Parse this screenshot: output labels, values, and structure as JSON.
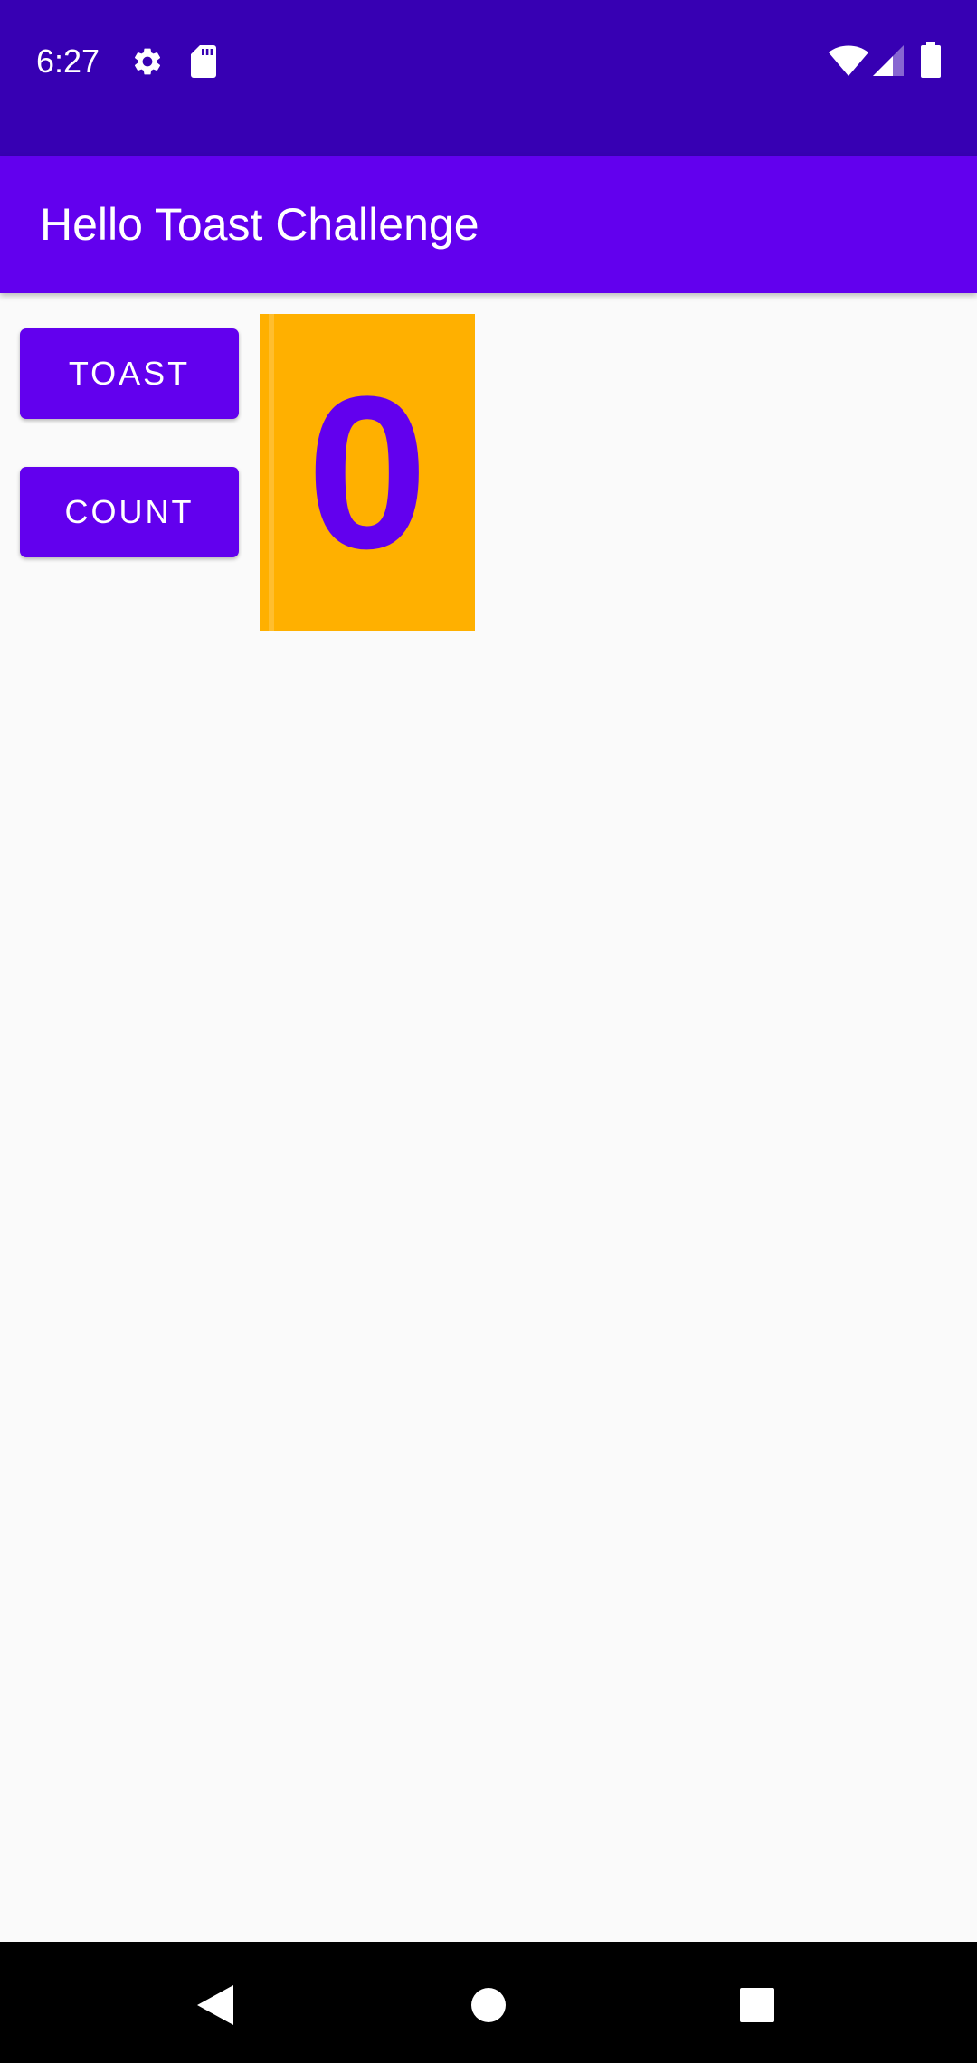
{
  "status_bar": {
    "time": "6:27",
    "icons": [
      "settings-gear-icon",
      "sd-card-icon",
      "wifi-icon",
      "cell-signal-icon",
      "battery-icon"
    ]
  },
  "app_bar": {
    "title": "Hello Toast Challenge"
  },
  "buttons": {
    "toast_label": "TOAST",
    "count_label": "COUNT"
  },
  "counter": {
    "value": "0"
  },
  "nav_bar": {
    "icons": [
      "back-icon",
      "home-icon",
      "recents-icon"
    ]
  },
  "colors": {
    "status_bar": "#3700b3",
    "primary": "#6200ee",
    "counter_background": "#ffb000",
    "background": "#fafafa",
    "nav_bar": "#000000"
  }
}
